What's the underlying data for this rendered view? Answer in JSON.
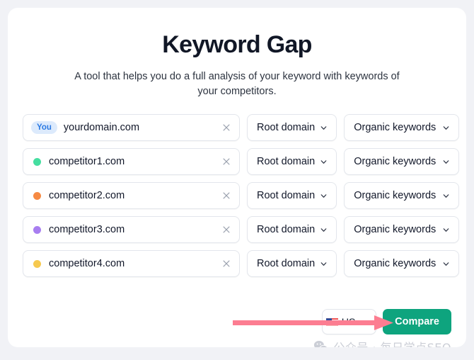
{
  "page": {
    "title": "Keyword Gap",
    "subtitle": "A tool that helps you do a full analysis of your keyword with keywords of your competitors."
  },
  "rows": [
    {
      "badge": "You",
      "domain": "yourdomain.com",
      "dot_color": null,
      "scope": "Root domain",
      "metric": "Organic keywords",
      "clear_icon": "close-icon"
    },
    {
      "badge": null,
      "domain": "competitor1.com",
      "dot_color": "#45dea0",
      "scope": "Root domain",
      "metric": "Organic keywords",
      "clear_icon": "close-icon"
    },
    {
      "badge": null,
      "domain": "competitor2.com",
      "dot_color": "#f68a43",
      "scope": "Root domain",
      "metric": "Organic keywords",
      "clear_icon": "close-icon"
    },
    {
      "badge": null,
      "domain": "competitor3.com",
      "dot_color": "#a87ef0",
      "scope": "Root domain",
      "metric": "Organic keywords",
      "clear_icon": "close-icon"
    },
    {
      "badge": null,
      "domain": "competitor4.com",
      "dot_color": "#f6c94f",
      "scope": "Root domain",
      "metric": "Organic keywords",
      "clear_icon": "close-icon"
    }
  ],
  "footer": {
    "country": "US",
    "country_flag_icon": "us-flag-icon",
    "compare_label": "Compare"
  },
  "annotation": {
    "arrow_color": "#fc7d91",
    "arrow_icon": "right-arrow-annotation"
  },
  "watermark": {
    "icon": "wechat-icon",
    "text": "公众号 · 每日学点SEO"
  },
  "colors": {
    "accent": "#0ea47e",
    "badge_bg": "#dceafc",
    "badge_text": "#2b7ae3",
    "page_bg": "#f1f2f6",
    "card_bg": "#ffffff"
  }
}
